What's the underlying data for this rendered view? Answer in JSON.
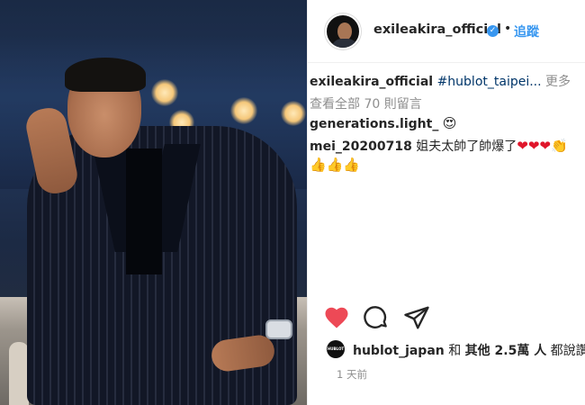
{
  "post": {
    "author": "exileakira_official",
    "follow_label": "追蹤",
    "separator": "•",
    "verified_mark": "✓"
  },
  "caption": {
    "user": "exileakira_official",
    "hashtag": "#hublot_taipei...",
    "more": "更多"
  },
  "view_comments": "查看全部 70 則留言",
  "comments": [
    {
      "user": "generations.light_",
      "text": "",
      "emojis": [
        "😍"
      ]
    },
    {
      "user": "mei_20200718",
      "text": "姐夫太帥了帥爆了",
      "emojis": [
        "❤",
        "❤",
        "❤",
        "👏"
      ],
      "emojis_line2": [
        "👍",
        "👍",
        "👍"
      ]
    }
  ],
  "likes": {
    "avatar_text": "HUBLOT",
    "user": "hublot_japan",
    "joiner": "和",
    "others": "其他 2.5萬 人",
    "suffix": "都說讚"
  },
  "time_ago": "1 天前",
  "icons": [
    "heart-icon",
    "comment-icon",
    "share-icon"
  ],
  "colors": {
    "link": "#3897f0",
    "heart": "#ed4956",
    "text": "#262626",
    "meta": "#8e8e8e"
  }
}
